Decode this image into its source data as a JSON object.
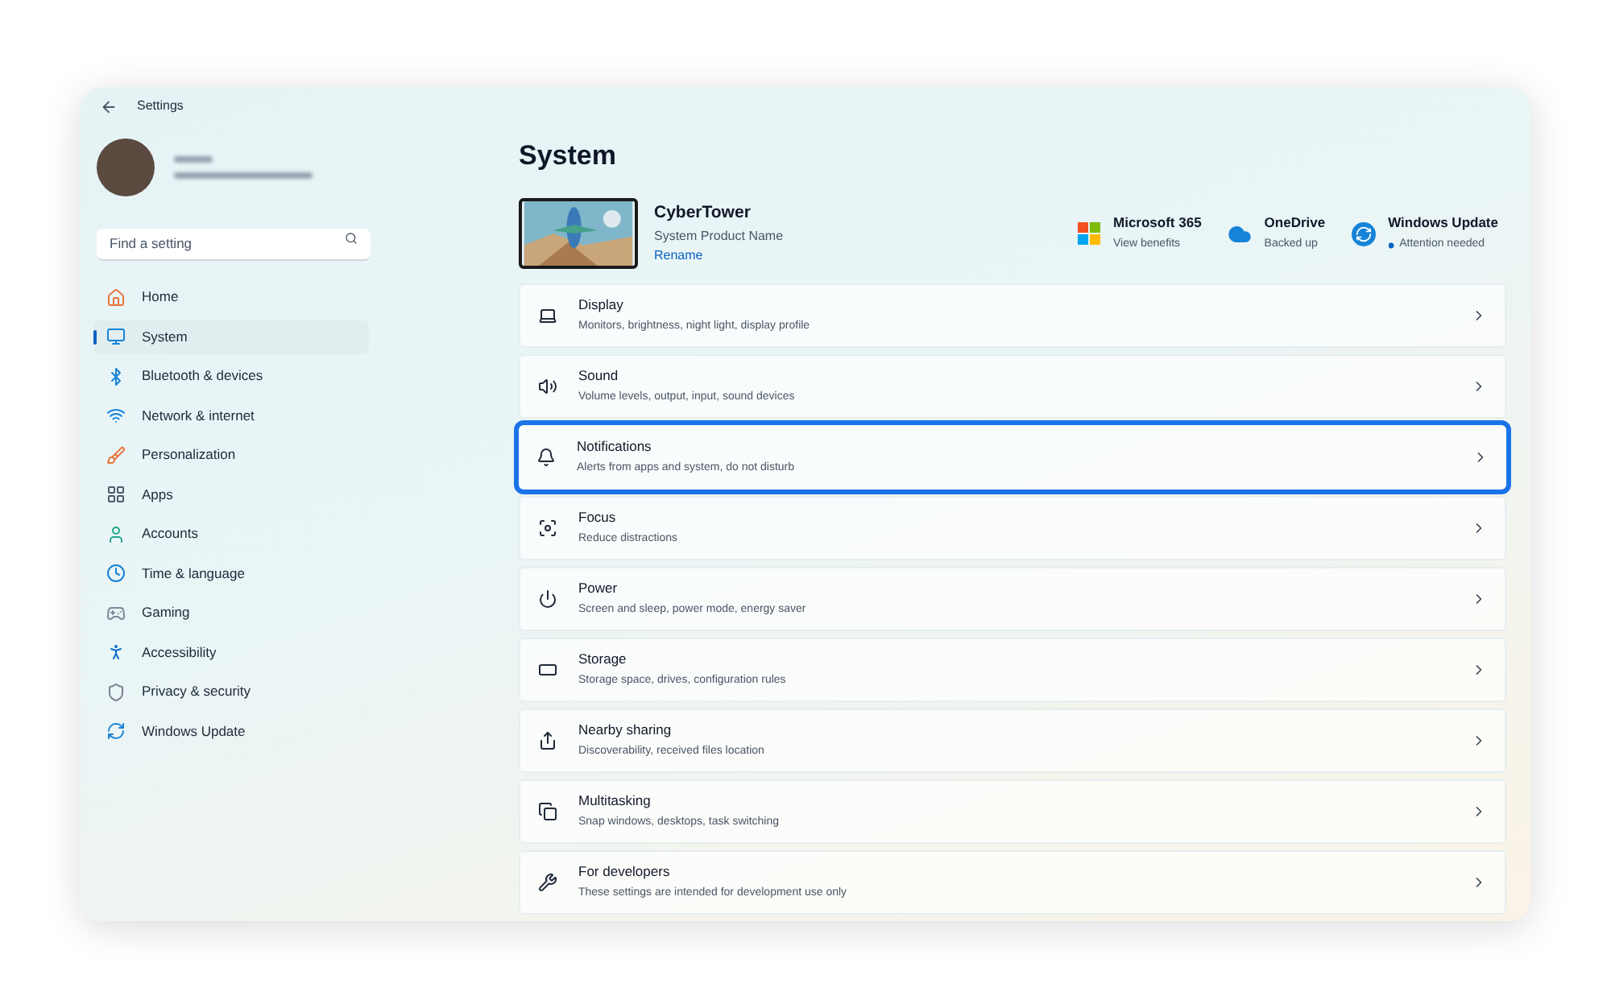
{
  "window": {
    "title": "Settings"
  },
  "search": {
    "placeholder": "Find a setting"
  },
  "nav": [
    {
      "label": "Home",
      "selected": false
    },
    {
      "label": "System",
      "selected": true
    },
    {
      "label": "Bluetooth & devices",
      "selected": false
    },
    {
      "label": "Network & internet",
      "selected": false
    },
    {
      "label": "Personalization",
      "selected": false
    },
    {
      "label": "Apps",
      "selected": false
    },
    {
      "label": "Accounts",
      "selected": false
    },
    {
      "label": "Time & language",
      "selected": false
    },
    {
      "label": "Gaming",
      "selected": false
    },
    {
      "label": "Accessibility",
      "selected": false
    },
    {
      "label": "Privacy & security",
      "selected": false
    },
    {
      "label": "Windows Update",
      "selected": false
    }
  ],
  "page_title": "System",
  "device": {
    "name": "CyberTower",
    "model": "System Product Name",
    "rename": "Rename"
  },
  "status_tiles": [
    {
      "title": "Microsoft 365",
      "subtitle": "View benefits",
      "attention": false
    },
    {
      "title": "OneDrive",
      "subtitle": "Backed up",
      "attention": false
    },
    {
      "title": "Windows Update",
      "subtitle": "Attention needed",
      "attention": true
    }
  ],
  "rows": [
    {
      "title": "Display",
      "subtitle": "Monitors, brightness, night light, display profile",
      "highlighted": false
    },
    {
      "title": "Sound",
      "subtitle": "Volume levels, output, input, sound devices",
      "highlighted": false
    },
    {
      "title": "Notifications",
      "subtitle": "Alerts from apps and system, do not disturb",
      "highlighted": true
    },
    {
      "title": "Focus",
      "subtitle": "Reduce distractions",
      "highlighted": false
    },
    {
      "title": "Power",
      "subtitle": "Screen and sleep, power mode, energy saver",
      "highlighted": false
    },
    {
      "title": "Storage",
      "subtitle": "Storage space, drives, configuration rules",
      "highlighted": false
    },
    {
      "title": "Nearby sharing",
      "subtitle": "Discoverability, received files location",
      "highlighted": false
    },
    {
      "title": "Multitasking",
      "subtitle": "Snap windows, desktops, task switching",
      "highlighted": false
    },
    {
      "title": "For developers",
      "subtitle": "These settings are intended for development use only",
      "highlighted": false
    }
  ]
}
